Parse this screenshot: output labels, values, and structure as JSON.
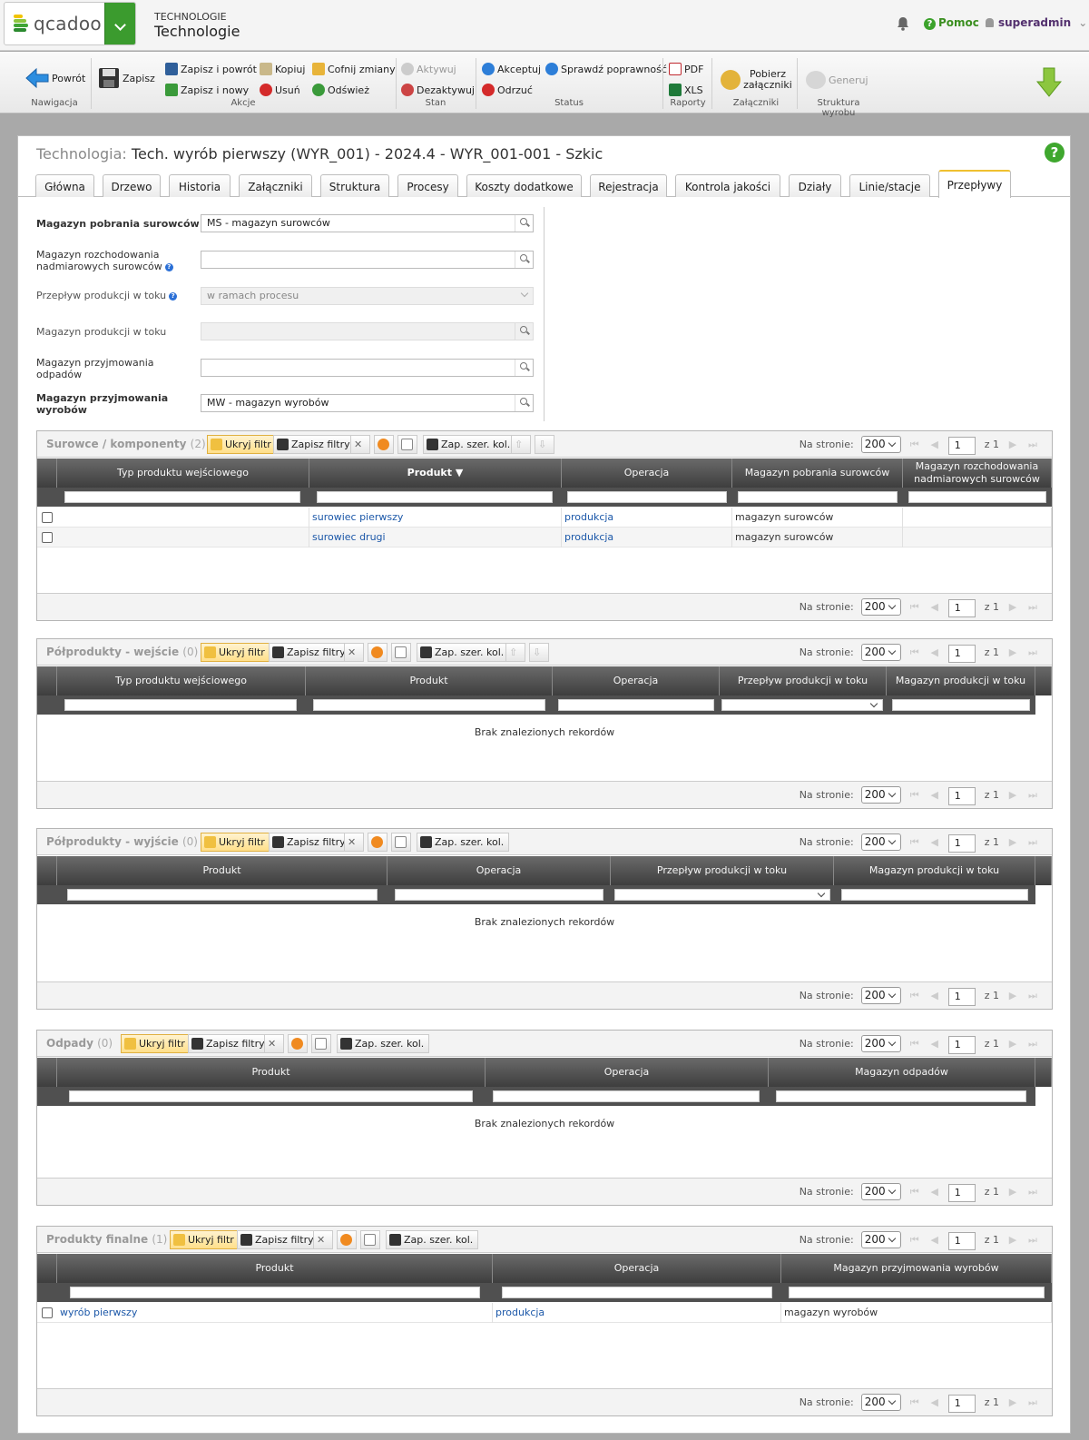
{
  "header": {
    "app_category": "TECHNOLOGIE",
    "app_title": "Technologie",
    "logo_text": "qcadoo",
    "help": "Pomoc",
    "user": "superadmin"
  },
  "ribbon": {
    "back": "Powrót",
    "save": "Zapisz",
    "save_back": "Zapisz i powrót",
    "save_new": "Zapisz i nowy",
    "copy": "Kopiuj",
    "delete": "Usuń",
    "undo": "Cofnij zmiany",
    "refresh": "Odśwież",
    "activate": "Aktywuj",
    "deactivate": "Dezaktywuj",
    "accept": "Akceptuj",
    "reject": "Odrzuć",
    "check": "Sprawdź poprawność",
    "pdf": "PDF",
    "xls": "XLS",
    "download_att": "Pobierz załączniki",
    "generate": "Generuj",
    "groups": {
      "nav": "Nawigacja",
      "actions": "Akcje",
      "state": "Stan",
      "status": "Status",
      "reports": "Raporty",
      "attachments": "Załączniki",
      "structure": "Struktura wyrobu"
    }
  },
  "page": {
    "title_prefix": "Technologia:",
    "title": "Tech. wyrób pierwszy (WYR_001) - 2024.4 - WYR_001-001 - Szkic"
  },
  "tabs": [
    "Główna",
    "Drzewo",
    "Historia",
    "Załączniki",
    "Struktura",
    "Procesy",
    "Koszty dodatkowe",
    "Rejestracja",
    "Kontrola jakości",
    "Działy",
    "Linie/stacje",
    "Przepływy"
  ],
  "form": {
    "f1_label": "Magazyn pobrania surowców",
    "f1_value": "MS - magazyn surowców",
    "f2_label": "Magazyn rozchodowania nadmiarowych surowców",
    "f2_value": "",
    "f3_label": "Przepływ produkcji w toku",
    "f3_value": "w ramach procesu",
    "f4_label": "Magazyn produkcji w toku",
    "f4_value": "",
    "f5_label": "Magazyn przyjmowania odpadów",
    "f5_value": "",
    "f6_label": "Magazyn przyjmowania wyrobów",
    "f6_value": "MW - magazyn wyrobów"
  },
  "toolbar": {
    "hide_filter": "Ukryj filtr",
    "save_filters": "Zapisz filtry",
    "save_widths": "Zap. szer. kol.",
    "per_page": "Na stronie:",
    "per_page_value": "200",
    "page": "1",
    "of": "z 1"
  },
  "grids": {
    "g1": {
      "title": "Surowce / komponenty",
      "count": "(2)",
      "cols": [
        "Typ produktu wejściowego",
        "Produkt",
        "Operacja",
        "Magazyn pobrania surowców",
        "Magazyn rozchodowania nadmiarowych surowców"
      ],
      "rows": [
        {
          "c1": "",
          "c2": "surowiec pierwszy",
          "c3": "produkcja",
          "c4": "magazyn surowców",
          "c5": ""
        },
        {
          "c1": "",
          "c2": "surowiec drugi",
          "c3": "produkcja",
          "c4": "magazyn surowców",
          "c5": ""
        }
      ]
    },
    "g2": {
      "title": "Półprodukty - wejście",
      "count": "(0)",
      "cols": [
        "Typ produktu wejściowego",
        "Produkt",
        "Operacja",
        "Przepływ produkcji w toku",
        "Magazyn produkcji w toku"
      ],
      "empty": "Brak znalezionych rekordów"
    },
    "g3": {
      "title": "Półprodukty - wyjście",
      "count": "(0)",
      "cols": [
        "Produkt",
        "Operacja",
        "Przepływ produkcji w toku",
        "Magazyn produkcji w toku"
      ],
      "empty": "Brak znalezionych rekordów"
    },
    "g4": {
      "title": "Odpady",
      "count": "(0)",
      "cols": [
        "Produkt",
        "Operacja",
        "Magazyn odpadów"
      ],
      "empty": "Brak znalezionych rekordów"
    },
    "g5": {
      "title": "Produkty finalne",
      "count": "(1)",
      "cols": [
        "Produkt",
        "Operacja",
        "Magazyn przyjmowania wyrobów"
      ],
      "rows": [
        {
          "c1": "wyrób pierwszy",
          "c2": "produkcja",
          "c3": "magazyn wyrobów"
        }
      ]
    }
  },
  "colors": {
    "brand_green": "#3b9b2e",
    "link": "#1b57a8",
    "header_dark": "#3e3e3e",
    "highlight": "#ffdf8a"
  }
}
